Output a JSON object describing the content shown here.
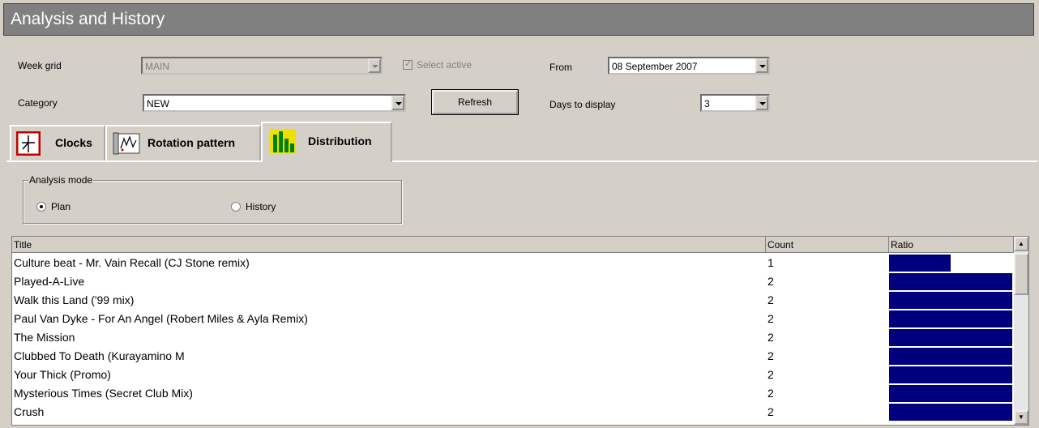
{
  "window": {
    "title": "Analysis and History"
  },
  "filters": {
    "week_grid_label": "Week grid",
    "week_grid_value": "MAIN",
    "select_active_label": "Select active",
    "from_label": "From",
    "from_value": "08 September 2007",
    "category_label": "Category",
    "category_value": "NEW",
    "refresh_label": "Refresh",
    "days_label": "Days to display",
    "days_value": "3"
  },
  "tabs": [
    {
      "label": "Clocks",
      "icon": "clock-icon"
    },
    {
      "label": "Rotation pattern",
      "icon": "rotation-chart-icon"
    },
    {
      "label": "Distribution",
      "icon": "bar-chart-icon",
      "active": true
    }
  ],
  "analysis": {
    "legend": "Analysis mode",
    "options": [
      {
        "label": "Plan",
        "selected": true
      },
      {
        "label": "History",
        "selected": false
      }
    ]
  },
  "table": {
    "columns": [
      "Title",
      "Count",
      "Ratio"
    ],
    "rows": [
      {
        "title": "Culture beat - Mr. Vain Recall (CJ Stone remix)",
        "count": "1",
        "ratio": 0.5
      },
      {
        "title": "Played-A-Live",
        "count": "2",
        "ratio": 1.0
      },
      {
        "title": "Walk this Land ('99 mix)",
        "count": "2",
        "ratio": 1.0
      },
      {
        "title": "Paul Van Dyke - For An Angel (Robert Miles & Ayla Remix)",
        "count": "2",
        "ratio": 1.0
      },
      {
        "title": "The Mission",
        "count": "2",
        "ratio": 1.0
      },
      {
        "title": "Clubbed To Death (Kurayamino M",
        "count": "2",
        "ratio": 1.0
      },
      {
        "title": "Your Thick (Promo)",
        "count": "2",
        "ratio": 1.0
      },
      {
        "title": "Mysterious Times (Secret Club Mix)",
        "count": "2",
        "ratio": 1.0
      },
      {
        "title": "Crush",
        "count": "2",
        "ratio": 1.0
      }
    ],
    "bar_color": "#00007f"
  }
}
